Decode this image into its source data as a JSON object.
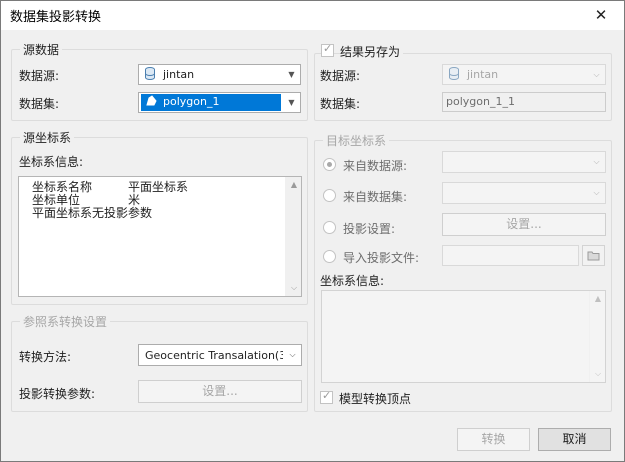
{
  "window": {
    "title": "数据集投影转换",
    "close_glyph": "✕"
  },
  "source_data": {
    "legend": "源数据",
    "datasource_label": "数据源:",
    "datasource_value": "jintan",
    "dataset_label": "数据集:",
    "dataset_value": "polygon_1"
  },
  "save_as": {
    "checkbox_label": "结果另存为",
    "checked": true,
    "datasource_label": "数据源:",
    "datasource_value": "jintan",
    "dataset_label": "数据集:",
    "dataset_value": "polygon_1_1"
  },
  "source_crs": {
    "legend": "源坐标系",
    "info_label": "坐标系信息:",
    "info_rows": [
      {
        "key": "坐标系名称",
        "value": "平面坐标系"
      },
      {
        "key": "坐标单位",
        "value": "米"
      },
      {
        "key": "平面坐标系无投影参数",
        "value": ""
      }
    ]
  },
  "target_crs": {
    "legend": "目标坐标系",
    "options": [
      {
        "label": "来自数据源:",
        "selected": true
      },
      {
        "label": "来自数据集:",
        "selected": false
      },
      {
        "label": "投影设置:",
        "selected": false
      },
      {
        "label": "导入投影文件:",
        "selected": false
      }
    ],
    "projection_settings_button": "设置...",
    "info_label": "坐标系信息:",
    "model_vertex_checkbox": "模型转换顶点",
    "model_vertex_checked": true
  },
  "reference_transform": {
    "legend": "参照系转换设置",
    "method_label": "转换方法:",
    "method_value": "Geocentric Transalation(3-p",
    "params_label": "投影转换参数:",
    "params_button": "设置..."
  },
  "footer": {
    "convert_button": "转换",
    "cancel_button": "取消"
  },
  "colors": {
    "selection": "#0078d7",
    "disabled_text": "#a6a6a6"
  }
}
